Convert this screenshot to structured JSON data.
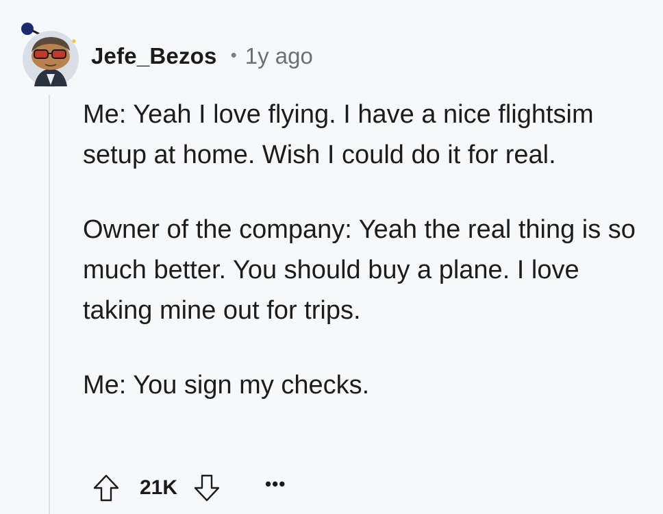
{
  "comment": {
    "username": "Jefe_Bezos",
    "separator": "•",
    "timestamp": "1y ago",
    "paragraphs": [
      "Me: Yeah I love flying. I have a nice flightsim setup at home. Wish I could do it for real.",
      "Owner of the company: Yeah the real thing is so much better. You should buy a plane. I love taking mine out for trips.",
      "Me: You sign my checks."
    ],
    "score": "21K",
    "more_label": "•••"
  },
  "icons": {
    "avatar": "snoo-avatar-icon",
    "upvote": "arrow-up-icon",
    "downvote": "arrow-down-icon",
    "more": "more-dots-icon"
  },
  "colors": {
    "background": "#f7f8fa",
    "text": "#1a1a1b",
    "muted": "#6b6f76",
    "thread_line": "#dfe3e8"
  }
}
